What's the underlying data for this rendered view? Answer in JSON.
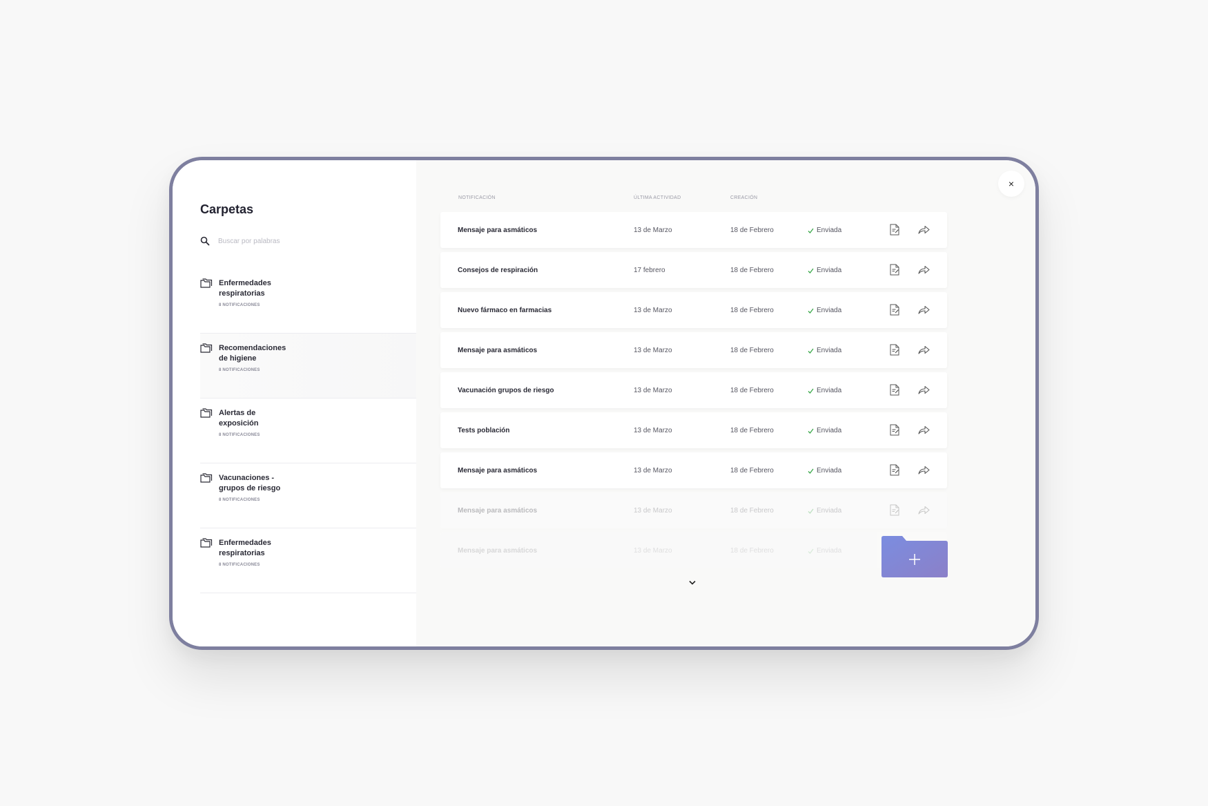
{
  "sidebar": {
    "title": "Carpetas",
    "search_placeholder": "Buscar por palabras",
    "folders": [
      {
        "name": "Enfermedades respiratorias",
        "count": "8 NOTIFICACIONES"
      },
      {
        "name": "Recomendaciones de higiene",
        "count": "8 NOTIFICACIONES"
      },
      {
        "name": "Alertas de exposición",
        "count": "8 NOTIFICACIONES"
      },
      {
        "name": "Vacunaciones - grupos de riesgo",
        "count": "8 NOTIFICACIONES"
      },
      {
        "name": "Enfermedades respiratorias",
        "count": "8 NOTIFICACIONES"
      }
    ]
  },
  "main": {
    "close_label": "×",
    "columns": {
      "notification": "NOTIFICACIÓN",
      "last_activity": "ÚLTIMA ACTIVIDAD",
      "created": "CREACIÓN"
    },
    "rows": [
      {
        "name": "Mensaje para asmáticos",
        "last": "13 de Marzo",
        "created": "18 de Febrero",
        "status": "Enviada"
      },
      {
        "name": "Consejos de respiración",
        "last": "17 febrero",
        "created": "18 de Febrero",
        "status": "Enviada"
      },
      {
        "name": "Nuevo fármaco en farmacias",
        "last": "13 de Marzo",
        "created": "18 de Febrero",
        "status": "Enviada"
      },
      {
        "name": "Mensaje para asmáticos",
        "last": "13 de Marzo",
        "created": "18 de Febrero",
        "status": "Enviada"
      },
      {
        "name": "Vacunación grupos de riesgo",
        "last": "13 de Marzo",
        "created": "18 de Febrero",
        "status": "Enviada"
      },
      {
        "name": "Tests población",
        "last": "13 de Marzo",
        "created": "18 de Febrero",
        "status": "Enviada"
      },
      {
        "name": "Mensaje para asmáticos",
        "last": "13 de Marzo",
        "created": "18 de Febrero",
        "status": "Enviada"
      },
      {
        "name": "Mensaje para asmáticos",
        "last": "13 de Marzo",
        "created": "18 de Febrero",
        "status": "Enviada"
      },
      {
        "name": "Mensaje para asmáticos",
        "last": "13 de Marzo",
        "created": "18 de Febrero",
        "status": "Enviada"
      }
    ]
  },
  "colors": {
    "frame": "#7e7f9f",
    "status_check": "#3aa84a",
    "add_button": "#7e88d8"
  },
  "icons": [
    "search-icon",
    "folder-icon",
    "close-icon",
    "document-edit-icon",
    "share-icon",
    "check-icon",
    "chevron-down-icon",
    "add-folder-icon"
  ]
}
